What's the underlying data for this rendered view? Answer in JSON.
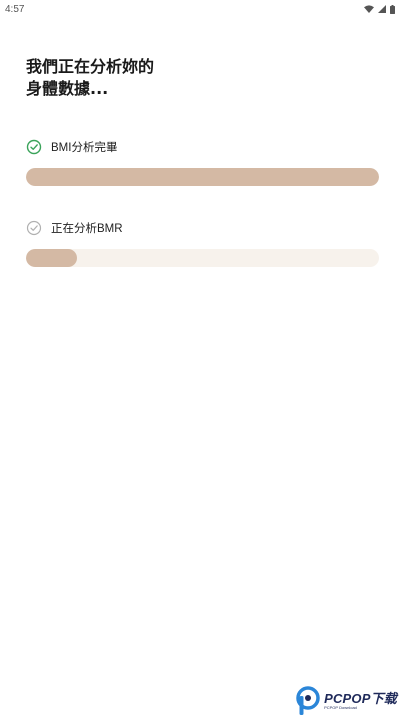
{
  "status_bar": {
    "time": "4:57",
    "icons": [
      "wifi-icon",
      "signal-icon",
      "battery-icon"
    ]
  },
  "headline": {
    "line1": "我們正在分析妳的",
    "line2": "身體數據..."
  },
  "tasks": [
    {
      "label": "BMI分析完畢",
      "status": "done",
      "icon": "check-circle-icon",
      "progress": 1.0
    },
    {
      "label": "正在分析BMR",
      "status": "in-progress",
      "icon": "check-circle-icon",
      "progress": 0.145
    }
  ],
  "colors": {
    "progress_fill": "#d4b9a4",
    "progress_track": "#f7f2ec",
    "check_done": "#3aa35a",
    "check_pending": "#b0b0b0"
  },
  "watermark": {
    "brand": "PCPOP下载",
    "sub": "PCPOP Download"
  }
}
